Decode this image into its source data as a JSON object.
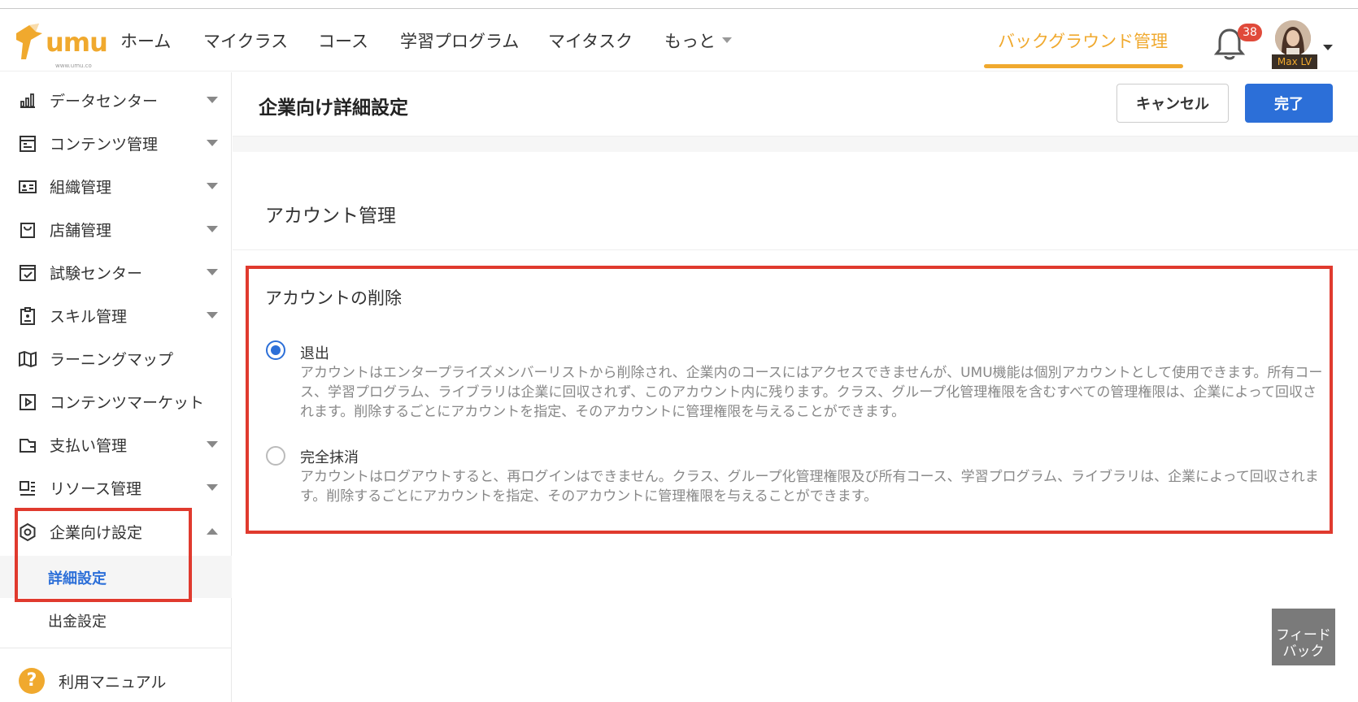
{
  "header": {
    "logo_text": "umu",
    "logo_url_text": "www.umu.co",
    "nav": {
      "home": "ホーム",
      "my_class": "マイクラス",
      "course": "コース",
      "program": "学習プログラム",
      "my_task": "マイタスク",
      "more": "もっと",
      "admin": "バックグラウンド管理"
    },
    "notification_count": "38",
    "user_name": "Max LV"
  },
  "sidebar": {
    "items": [
      {
        "label": "データセンター",
        "icon": "chart-icon"
      },
      {
        "label": "コンテンツ管理",
        "icon": "content-icon"
      },
      {
        "label": "組織管理",
        "icon": "id-card-icon"
      },
      {
        "label": "店舗管理",
        "icon": "shopping-bag-icon"
      },
      {
        "label": "試験センター",
        "icon": "checkbox-icon"
      },
      {
        "label": "スキル管理",
        "icon": "clipboard-icon"
      },
      {
        "label": "ラーニングマップ",
        "icon": "map-icon"
      },
      {
        "label": "コンテンツマーケット",
        "icon": "play-icon"
      },
      {
        "label": "支払い管理",
        "icon": "wallet-icon"
      },
      {
        "label": "リソース管理",
        "icon": "list-icon"
      },
      {
        "label": "企業向け設定",
        "icon": "settings-icon"
      }
    ],
    "sub_items": [
      {
        "label": "詳細設定"
      },
      {
        "label": "出金設定"
      }
    ],
    "help_label": "利用マニュアル"
  },
  "main": {
    "title": "企業向け詳細設定",
    "cancel_label": "キャンセル",
    "done_label": "完了",
    "section_title": "アカウント管理",
    "delete_title": "アカウントの削除",
    "options": [
      {
        "label": "退出",
        "selected": true,
        "description": "アカウントはエンタープライズメンバーリストから削除され、企業内のコースにはアクセスできませんが、UMU機能は個別アカウントとして使用できます。所有コース、学習プログラム、ライブラリは企業に回収されず、このアカウント内に残ります。クラス、グループ化管理権限を含むすべての管理権限は、企業によって回収されます。削除するごとにアカウントを指定、そのアカウントに管理権限を与えることができます。"
      },
      {
        "label": "完全抹消",
        "selected": false,
        "description": "アカウントはログアウトすると、再ログインはできません。クラス、グループ化管理権限及び所有コース、学習プログラム、ライブラリは、企業によって回収されます。削除するごとにアカウントを指定、そのアカウントに管理権限を与えることができます。"
      }
    ]
  },
  "feedback_label": "フィード バック",
  "colors": {
    "accent": "#f0a92e",
    "primary": "#2c6fd8",
    "highlight": "#e03a2e"
  }
}
